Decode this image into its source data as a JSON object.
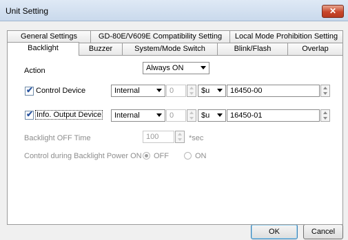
{
  "window": {
    "title": "Unit Setting",
    "close_glyph": "✕"
  },
  "tabs_row1": [
    "General Settings",
    "GD-80E/V609E Compatibility Setting",
    "Local Mode Prohibition Setting"
  ],
  "tabs_row2": [
    "Backlight",
    "Buzzer",
    "System/Mode Switch",
    "Blink/Flash",
    "Overlap"
  ],
  "backlight": {
    "action_label": "Action",
    "action_value": "Always ON",
    "control_device": {
      "label": "Control Device",
      "checked": true,
      "device_type": "Internal",
      "index": "0",
      "prefix": "$u",
      "address": "16450-00"
    },
    "info_output_device": {
      "label": "Info. Output Device",
      "checked": true,
      "device_type": "Internal",
      "index": "0",
      "prefix": "$u",
      "address": "16450-01"
    },
    "off_time": {
      "label": "Backlight OFF Time",
      "value": "100",
      "unit": "*sec"
    },
    "power_on": {
      "label": "Control during Backlight Power ON",
      "off_label": "OFF",
      "on_label": "ON",
      "selected": "OFF"
    }
  },
  "buttons": {
    "ok": "OK",
    "cancel": "Cancel"
  },
  "icons": {
    "check": "✔"
  },
  "colors": {
    "title_bg": "#c9d9ec",
    "close_bg": "#c8462b",
    "check": "#2a55a0"
  }
}
